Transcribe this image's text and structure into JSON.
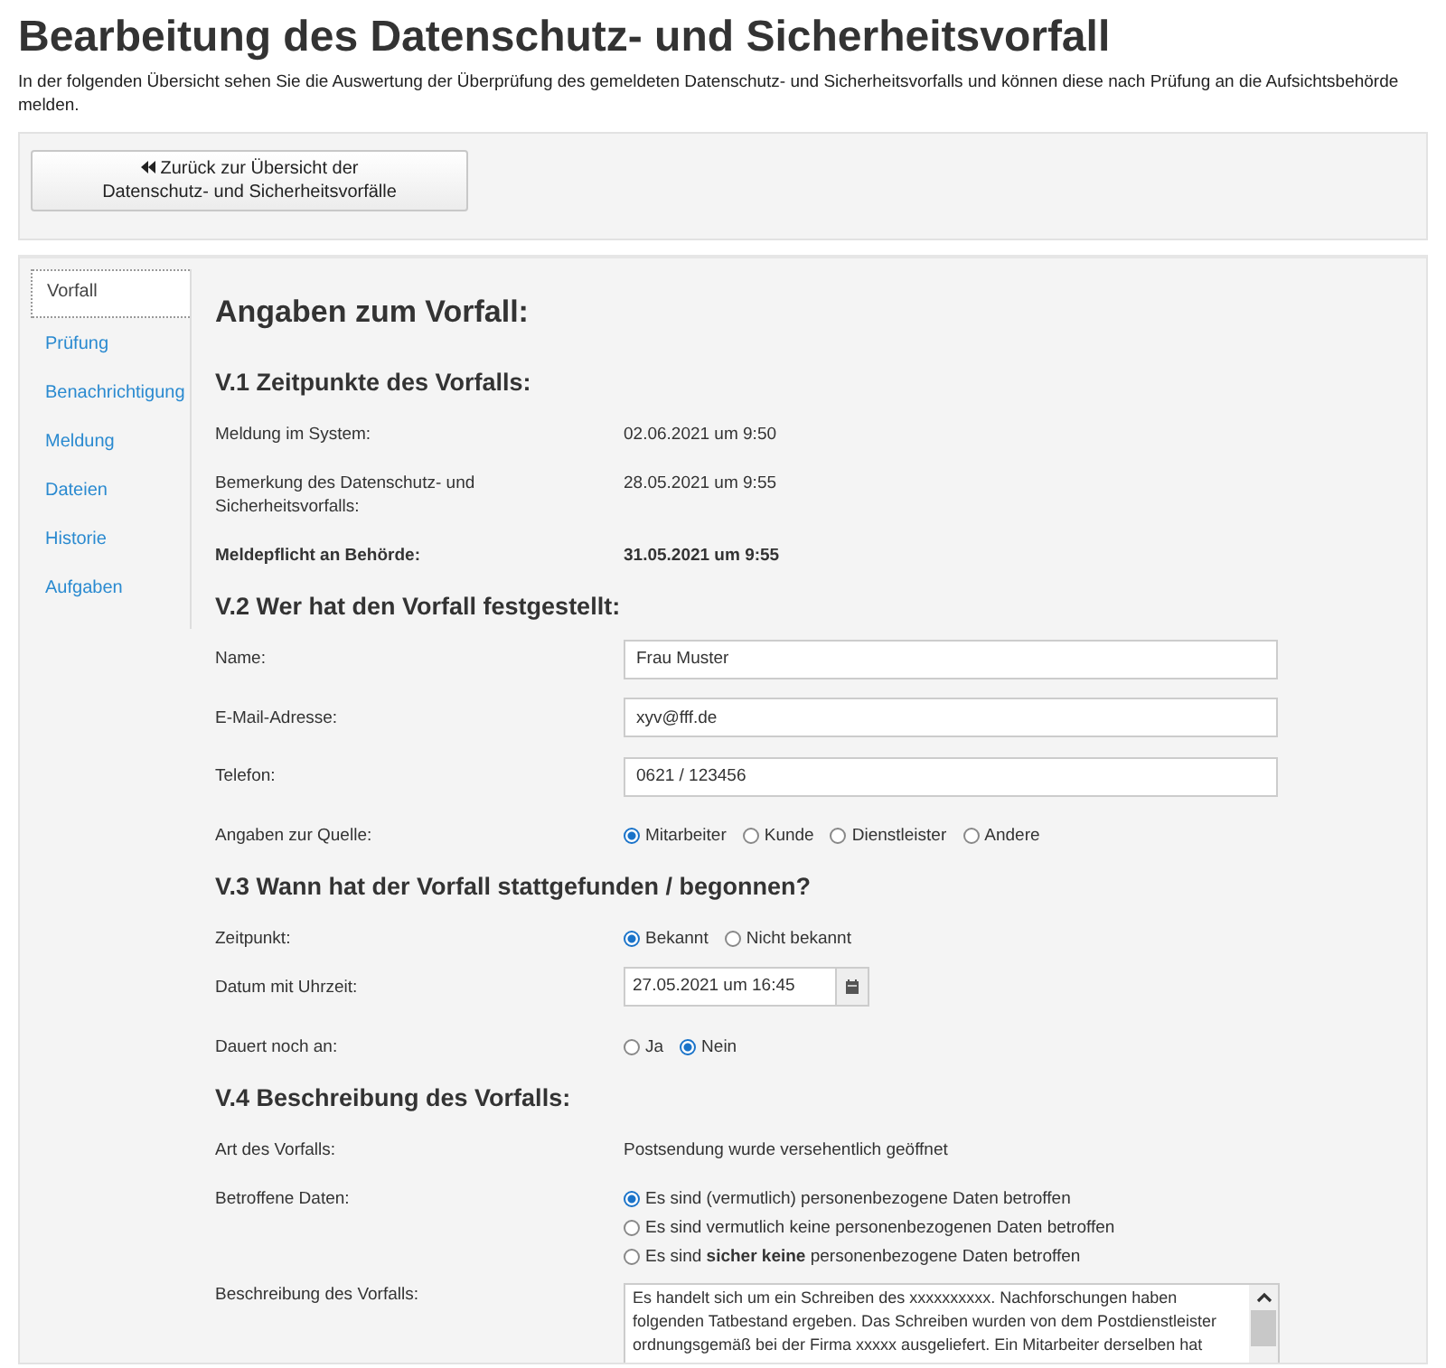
{
  "page_title": "Bearbeitung des Datenschutz- und Sicherheitsvorfall",
  "intro": "In der folgenden Übersicht sehen Sie die Auswertung der Überprüfung des gemeldeten Datenschutz- und Sicherheitsvorfalls und können diese nach Prüfung an die Aufsichtsbehörde melden.",
  "back_button": {
    "label": "Zurück zur Übersicht der Datenschutz- und Sicherheitsvorfälle"
  },
  "sidebar": {
    "items": [
      {
        "label": "Vorfall",
        "selected": true
      },
      {
        "label": "Prüfung",
        "selected": false
      },
      {
        "label": "Benachrichtigung",
        "selected": false
      },
      {
        "label": "Meldung",
        "selected": false
      },
      {
        "label": "Dateien",
        "selected": false
      },
      {
        "label": "Historie",
        "selected": false
      },
      {
        "label": "Aufgaben",
        "selected": false
      }
    ]
  },
  "content_title": "Angaben zum Vorfall:",
  "sections": [
    {
      "heading": "V.1 Zeitpunkte des Vorfalls:",
      "rows": [
        {
          "kind": "text",
          "label": "Meldung im System:",
          "value": "02.06.2021 um 9:50",
          "bold": false
        },
        {
          "kind": "text",
          "label": "Bemerkung des Datenschutz- und Sicherheitsvorfalls:",
          "value": "28.05.2021 um 9:55",
          "bold": false
        },
        {
          "kind": "text",
          "label": "Meldepflicht an Behörde:",
          "value": "31.05.2021 um 9:55",
          "bold": true
        }
      ]
    },
    {
      "heading": "V.2 Wer hat den Vorfall festgestellt:",
      "rows": [
        {
          "kind": "input",
          "label": "Name:",
          "value": "Frau Muster"
        },
        {
          "kind": "input",
          "label": "E-Mail-Adresse:",
          "value": "xyv@fff.de"
        },
        {
          "kind": "input",
          "label": "Telefon:",
          "value": "0621 / 123456"
        },
        {
          "kind": "radio",
          "label": "Angaben zur Quelle:",
          "options": [
            {
              "label": "Mitarbeiter",
              "selected": true
            },
            {
              "label": "Kunde",
              "selected": false
            },
            {
              "label": "Dienstleister",
              "selected": false
            },
            {
              "label": "Andere",
              "selected": false
            }
          ]
        }
      ]
    },
    {
      "heading": "V.3 Wann hat der Vorfall stattgefunden / begonnen?",
      "rows": [
        {
          "kind": "radio",
          "label": "Zeitpunkt:",
          "options": [
            {
              "label": "Bekannt",
              "selected": true
            },
            {
              "label": "Nicht bekannt",
              "selected": false
            }
          ]
        },
        {
          "kind": "date",
          "label": "Datum mit Uhrzeit:",
          "value": "27.05.2021 um 16:45"
        },
        {
          "kind": "radio",
          "label": "Dauert noch an:",
          "options": [
            {
              "label": "Ja",
              "selected": false
            },
            {
              "label": "Nein",
              "selected": true
            }
          ]
        }
      ]
    },
    {
      "heading": "V.4 Beschreibung des Vorfalls:",
      "rows": [
        {
          "kind": "text",
          "label": "Art des Vorfalls:",
          "value": "Postsendung wurde versehentlich geöffnet",
          "bold": false
        },
        {
          "kind": "radio-list",
          "label": "Betroffene Daten:",
          "options": [
            {
              "label": "Es sind (vermutlich) personenbezogene Daten betroffen",
              "selected": true
            },
            {
              "label": "Es sind vermutlich keine personenbezogenen Daten betroffen",
              "selected": false
            },
            {
              "label": "Es sind **sicher keine** personenbezogene Daten betroffen",
              "selected": false
            }
          ]
        },
        {
          "kind": "textarea",
          "label": "Beschreibung des Vorfalls:",
          "value": "Es handelt sich um ein Schreiben des xxxxxxxxxx. Nachforschungen haben\nfolgenden Tatbestand ergeben. Das Schreiben wurden von dem Postdienstleister\nordnungsgemäß bei der Firma xxxxx ausgeliefert. Ein Mitarbeiter derselben hat"
        }
      ]
    }
  ]
}
